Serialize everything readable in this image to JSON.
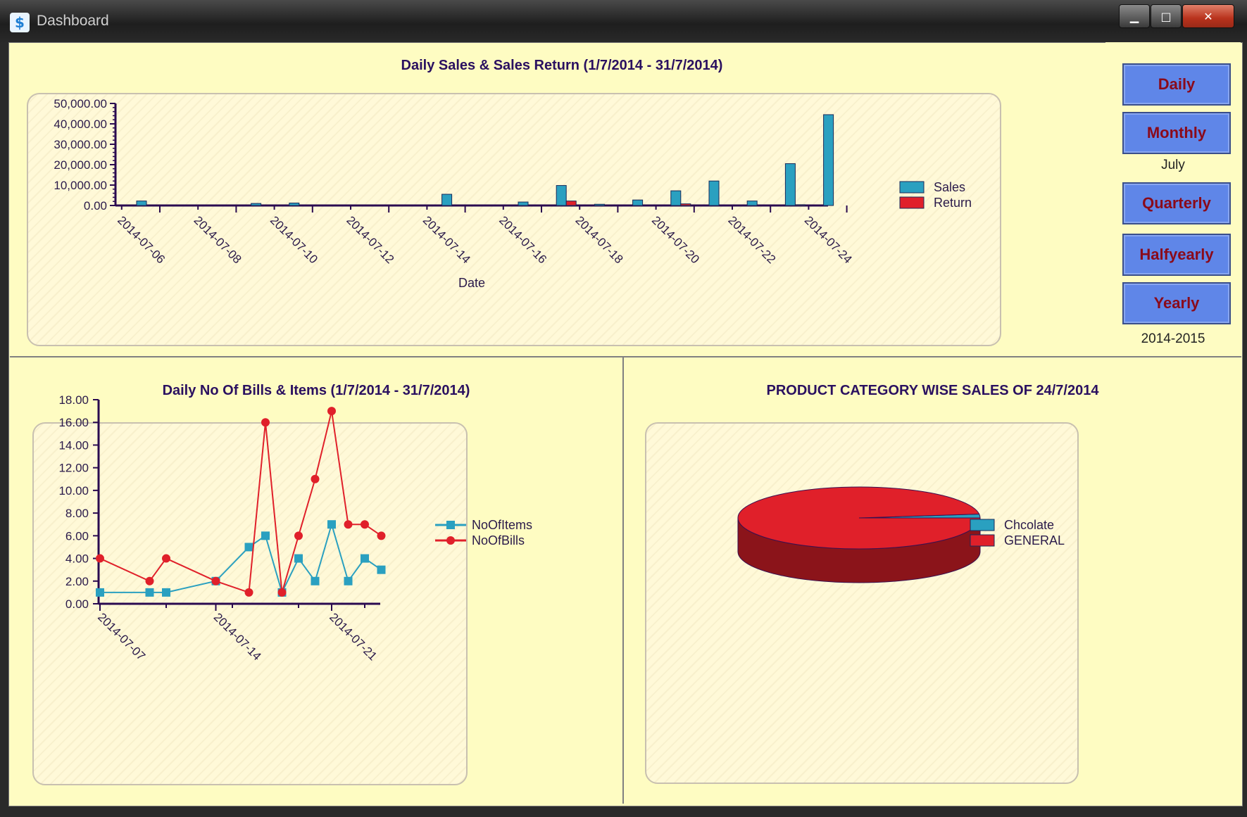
{
  "window": {
    "title": "Dashboard",
    "buttons": [
      "minimize",
      "maximize",
      "close"
    ]
  },
  "side": {
    "daily": "Daily",
    "monthly": "Monthly",
    "month_value": "July",
    "quarterly": "Quarterly",
    "halfyearly": "Halfyearly",
    "yearly": "Yearly",
    "year_value": "2014-2015"
  },
  "chart_data": [
    {
      "type": "bar",
      "title": "Daily Sales & Sales Return (1/7/2014 - 31/7/2014)",
      "xlabel": "Date",
      "ylabel": "",
      "ylim": [
        0,
        50000
      ],
      "y_ticks": [
        "0.00",
        "10,000.00",
        "20,000.00",
        "30,000.00",
        "40,000.00",
        "50,000.00"
      ],
      "x_ticks": [
        "2014-07-06",
        "2014-07-08",
        "2014-07-10",
        "2014-07-12",
        "2014-07-14",
        "2014-07-16",
        "2014-07-18",
        "2014-07-20",
        "2014-07-22",
        "2014-07-24"
      ],
      "legend_position": "right",
      "series": [
        {
          "name": "Sales",
          "color": "#2aa0c0",
          "points": [
            {
              "x": "2014-07-06",
              "y": 2200
            },
            {
              "x": "2014-07-09",
              "y": 1000
            },
            {
              "x": "2014-07-10",
              "y": 1200
            },
            {
              "x": "2014-07-14",
              "y": 5500
            },
            {
              "x": "2014-07-16",
              "y": 1700
            },
            {
              "x": "2014-07-17",
              "y": 9800
            },
            {
              "x": "2014-07-18",
              "y": 600
            },
            {
              "x": "2014-07-19",
              "y": 2700
            },
            {
              "x": "2014-07-20",
              "y": 7200
            },
            {
              "x": "2014-07-21",
              "y": 12000
            },
            {
              "x": "2014-07-22",
              "y": 2200
            },
            {
              "x": "2014-07-23",
              "y": 20500
            },
            {
              "x": "2014-07-24",
              "y": 44500
            }
          ]
        },
        {
          "name": "Return",
          "color": "#e0202a",
          "points": [
            {
              "x": "2014-07-17",
              "y": 2200
            },
            {
              "x": "2014-07-20",
              "y": 800
            },
            {
              "x": "2014-07-23",
              "y": 400
            }
          ]
        }
      ]
    },
    {
      "type": "line",
      "title": "Daily No Of Bills & Items (1/7/2014 - 31/7/2014)",
      "xlabel": "",
      "ylabel": "",
      "ylim": [
        0,
        18
      ],
      "y_ticks": [
        "0.00",
        "2.00",
        "4.00",
        "6.00",
        "8.00",
        "10.00",
        "12.00",
        "14.00",
        "16.00",
        "18.00"
      ],
      "x_ticks": [
        "2014-07-07",
        "2014-07-14",
        "2014-07-21"
      ],
      "legend_position": "right",
      "series": [
        {
          "name": "NoOfItems",
          "color": "#2aa0c0",
          "marker": "square",
          "points": [
            {
              "x": "2014-07-07",
              "y": 1
            },
            {
              "x": "2014-07-10",
              "y": 1
            },
            {
              "x": "2014-07-11",
              "y": 1
            },
            {
              "x": "2014-07-14",
              "y": 2
            },
            {
              "x": "2014-07-16",
              "y": 5
            },
            {
              "x": "2014-07-17",
              "y": 6
            },
            {
              "x": "2014-07-18",
              "y": 1
            },
            {
              "x": "2014-07-19",
              "y": 4
            },
            {
              "x": "2014-07-20",
              "y": 2
            },
            {
              "x": "2014-07-21",
              "y": 7
            },
            {
              "x": "2014-07-22",
              "y": 2
            },
            {
              "x": "2014-07-23",
              "y": 4
            },
            {
              "x": "2014-07-24",
              "y": 3
            }
          ]
        },
        {
          "name": "NoOfBills",
          "color": "#e0202a",
          "marker": "circle",
          "points": [
            {
              "x": "2014-07-07",
              "y": 4
            },
            {
              "x": "2014-07-10",
              "y": 2
            },
            {
              "x": "2014-07-11",
              "y": 4
            },
            {
              "x": "2014-07-14",
              "y": 2
            },
            {
              "x": "2014-07-16",
              "y": 1
            },
            {
              "x": "2014-07-17",
              "y": 16
            },
            {
              "x": "2014-07-18",
              "y": 1
            },
            {
              "x": "2014-07-19",
              "y": 6
            },
            {
              "x": "2014-07-20",
              "y": 11
            },
            {
              "x": "2014-07-21",
              "y": 17
            },
            {
              "x": "2014-07-22",
              "y": 7
            },
            {
              "x": "2014-07-23",
              "y": 7
            },
            {
              "x": "2014-07-24",
              "y": 6
            }
          ]
        }
      ]
    },
    {
      "type": "pie",
      "title": "PRODUCT CATEGORY WISE SALES OF 24/7/2014",
      "legend_position": "right",
      "slices": [
        {
          "name": "Chcolate",
          "value": 2,
          "color": "#2aa0c0"
        },
        {
          "name": "GENERAL",
          "value": 98,
          "color": "#e0202a"
        }
      ]
    }
  ]
}
